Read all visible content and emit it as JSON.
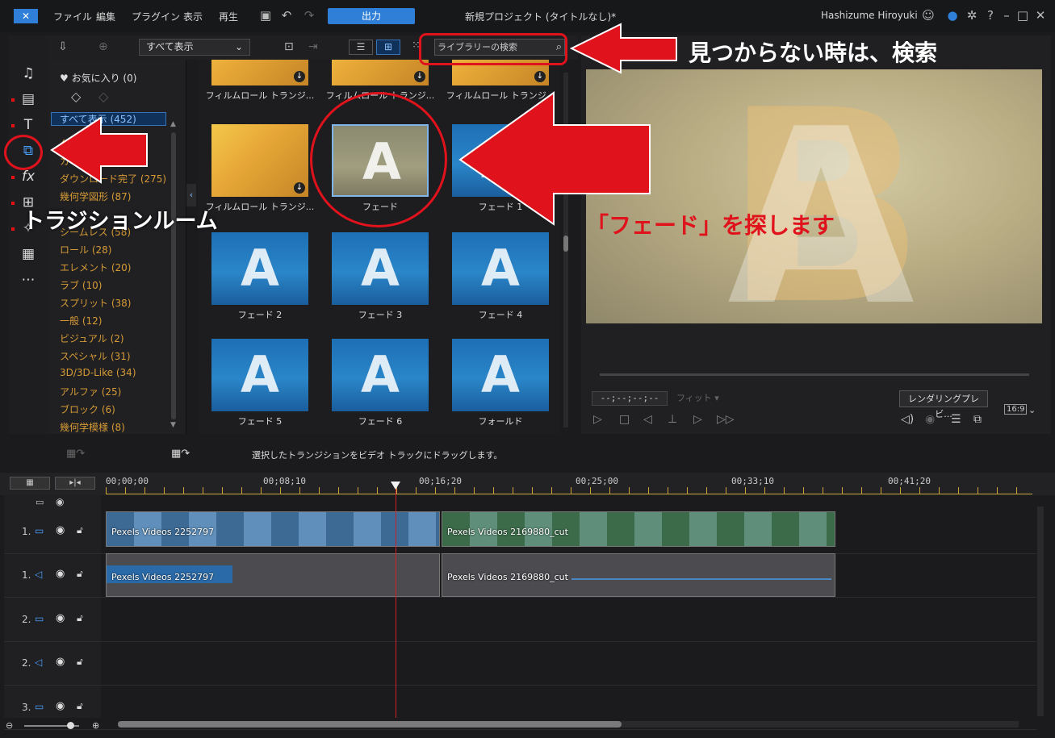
{
  "menubar": {
    "items": [
      "ファイル",
      "編集",
      "プラグイン",
      "表示",
      "再生"
    ],
    "output_label": "出力",
    "project_title": "新規プロジェクト (タイトルなし)*",
    "user_name": "Hashizume Hiroyuki"
  },
  "library": {
    "show_all_label": "すべて表示",
    "search_placeholder": "ライブラリーの検索",
    "favorites": "お気に入り (0)",
    "selected_category": "すべて表示 (452)",
    "categories": [
      "グ",
      "カ",
      "ダウンロード完了 (275)",
      "幾何学図形 (87)",
      "",
      "シームレス (58)",
      "ロール (28)",
      "エレメント (20)",
      "ラブ (10)",
      "スプリット (38)",
      "一般 (12)",
      "ビジュアル (2)",
      "スペシャル (31)",
      "3D/3D-Like (34)",
      "アルファ (25)",
      "ブロック (6)",
      "幾何学模様 (8)"
    ],
    "thumbnails": [
      {
        "label": "フィルムロール トランジ...",
        "style": "gold"
      },
      {
        "label": "フィルムロール トランジ...",
        "style": "gold"
      },
      {
        "label": "フィルムロール トランジ...",
        "style": "gold"
      },
      {
        "label": "フィルムロール トランジ...",
        "style": "gold"
      },
      {
        "label": "フェード",
        "style": "fade"
      },
      {
        "label": "フェード 1",
        "style": "blue"
      },
      {
        "label": "フェード 2",
        "style": "blue"
      },
      {
        "label": "フェード 3",
        "style": "blue"
      },
      {
        "label": "フェード 4",
        "style": "blue"
      },
      {
        "label": "フェード 5",
        "style": "blue"
      },
      {
        "label": "フェード 6",
        "style": "blue"
      },
      {
        "label": "フォールド",
        "style": "blue"
      }
    ]
  },
  "preview": {
    "timecode": "--;--;--;--",
    "fit_label": "フィット",
    "render_label": "レンダリングプレビ...",
    "aspect_label": "16:9"
  },
  "status": {
    "text": "選択したトランジションをビデオ トラックにドラッグします。"
  },
  "timeline": {
    "ticks": [
      "00;00;00",
      "00;08;10",
      "00;16;20",
      "00;25;00",
      "00;33;10",
      "00;41;20"
    ],
    "tracks": [
      "1.",
      "1.",
      "2.",
      "2.",
      "3."
    ],
    "clips": {
      "video1": "Pexels Videos 2252797",
      "video2": "Pexels Videos 2169880_cut",
      "audio1": "Pexels Videos 2252797",
      "audio2": "Pexels Videos 2169880_cut"
    }
  },
  "annotations": {
    "search_note": "見つからない時は、検索",
    "room_note": "トラジションルーム",
    "fade_note": "「フェード」を探します"
  },
  "colors": {
    "accent": "#2f7fd8",
    "annotation_red": "#e0121c",
    "category_text": "#d59a35"
  }
}
